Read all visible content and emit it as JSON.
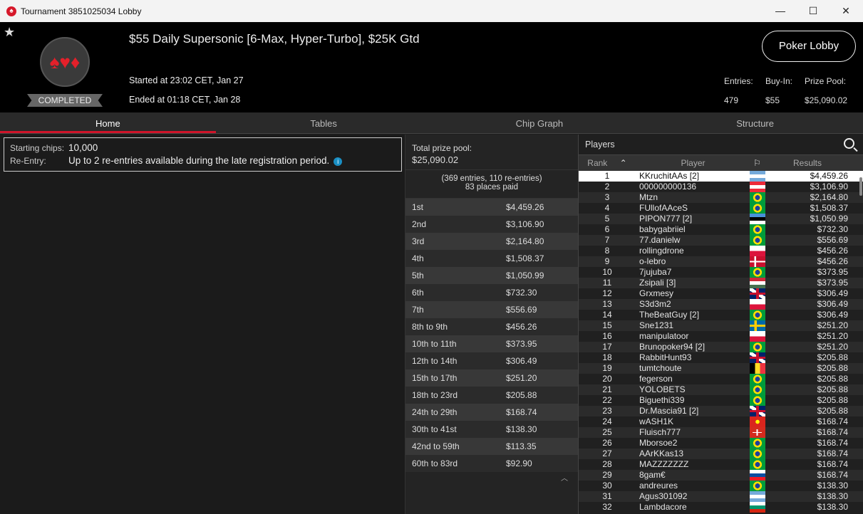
{
  "window": {
    "title": "Tournament 3851025034 Lobby"
  },
  "header": {
    "title": "$55 Daily Supersonic [6-Max, Hyper-Turbo], $25K Gtd",
    "started": "Started at 23:02 CET, Jan 27",
    "ended": "Ended at 01:18 CET, Jan 28",
    "status": "COMPLETED",
    "lobby_button": "Poker Lobby",
    "stats": {
      "entries_label": "Entries:",
      "entries": "479",
      "buyin_label": "Buy-In:",
      "buyin": "$55",
      "prize_label": "Prize Pool:",
      "prize": "$25,090.02"
    }
  },
  "tabs": [
    "Home",
    "Tables",
    "Chip Graph",
    "Structure"
  ],
  "home": {
    "chips_label": "Starting chips:",
    "chips": "10,000",
    "reentry_label": "Re-Entry:",
    "reentry": "Up to 2 re-entries available during the late registration period."
  },
  "payouts": {
    "total_label": "Total prize pool:",
    "total": "$25,090.02",
    "entries_note": "(369 entries, 110 re-entries)",
    "places_paid": "83 places paid",
    "rows": [
      [
        "1st",
        "$4,459.26"
      ],
      [
        "2nd",
        "$3,106.90"
      ],
      [
        "3rd",
        "$2,164.80"
      ],
      [
        "4th",
        "$1,508.37"
      ],
      [
        "5th",
        "$1,050.99"
      ],
      [
        "6th",
        "$732.30"
      ],
      [
        "7th",
        "$556.69"
      ],
      [
        "8th to 9th",
        "$456.26"
      ],
      [
        "10th to 11th",
        "$373.95"
      ],
      [
        "12th to 14th",
        "$306.49"
      ],
      [
        "15th to 17th",
        "$251.20"
      ],
      [
        "18th to 23rd",
        "$205.88"
      ],
      [
        "24th to 29th",
        "$168.74"
      ],
      [
        "30th to 41st",
        "$138.30"
      ],
      [
        "42nd to 59th",
        "$113.35"
      ],
      [
        "60th to 83rd",
        "$92.90"
      ]
    ]
  },
  "players": {
    "title": "Players",
    "columns": [
      "Rank",
      "Player",
      "Results"
    ],
    "rows": [
      [
        "1",
        "KKruchitAAs [2]",
        "ar",
        "$4,459.26"
      ],
      [
        "2",
        "000000000136",
        "at",
        "$3,106.90"
      ],
      [
        "3",
        "Mtzn",
        "br",
        "$2,164.80"
      ],
      [
        "4",
        "FUllofAAceS",
        "br",
        "$1,508.37"
      ],
      [
        "5",
        "PIPON777 [2]",
        "ee",
        "$1,050.99"
      ],
      [
        "6",
        "babygabriiel",
        "br",
        "$732.30"
      ],
      [
        "7",
        "77.danielw",
        "br",
        "$556.69"
      ],
      [
        "8",
        "rollingdrone",
        "pl",
        "$456.26"
      ],
      [
        "9",
        "o-lebro",
        "dk",
        "$456.26"
      ],
      [
        "10",
        "7jujuba7",
        "br",
        "$373.95"
      ],
      [
        "11",
        "Zsipali [3]",
        "hu",
        "$373.95"
      ],
      [
        "12",
        "Grxmesy",
        "gb",
        "$306.49"
      ],
      [
        "13",
        "S3d3m2",
        "pl",
        "$306.49"
      ],
      [
        "14",
        "TheBeatGuy [2]",
        "br",
        "$306.49"
      ],
      [
        "15",
        "Sne1231",
        "se",
        "$251.20"
      ],
      [
        "16",
        "manipulatoor",
        "pl",
        "$251.20"
      ],
      [
        "17",
        "Brunopoker94 [2]",
        "br",
        "$251.20"
      ],
      [
        "18",
        "RabbitHunt93",
        "gb",
        "$205.88"
      ],
      [
        "19",
        "tumtchoute",
        "be",
        "$205.88"
      ],
      [
        "20",
        "fegerson",
        "br",
        "$205.88"
      ],
      [
        "21",
        "YOLOBETS",
        "br",
        "$205.88"
      ],
      [
        "22",
        "Biguethi339",
        "br",
        "$205.88"
      ],
      [
        "23",
        "Dr.Mascia91 [2]",
        "gb",
        "$205.88"
      ],
      [
        "24",
        "wASH1K",
        "vn",
        "$168.74"
      ],
      [
        "25",
        "Fluisch777",
        "ch",
        "$168.74"
      ],
      [
        "26",
        "Mborsoe2",
        "br",
        "$168.74"
      ],
      [
        "27",
        "AArKKas13",
        "br",
        "$168.74"
      ],
      [
        "28",
        "MAZZZZZZZ",
        "br",
        "$168.74"
      ],
      [
        "29",
        "8gam€",
        "sk",
        "$168.74"
      ],
      [
        "30",
        "andreures",
        "br",
        "$138.30"
      ],
      [
        "31",
        "Agus301092",
        "ar",
        "$138.30"
      ],
      [
        "32",
        "Lambdacore",
        "bg",
        "$138.30"
      ]
    ]
  },
  "colors": {
    "accent": "#d0142a",
    "info": "#1a8fc4"
  }
}
